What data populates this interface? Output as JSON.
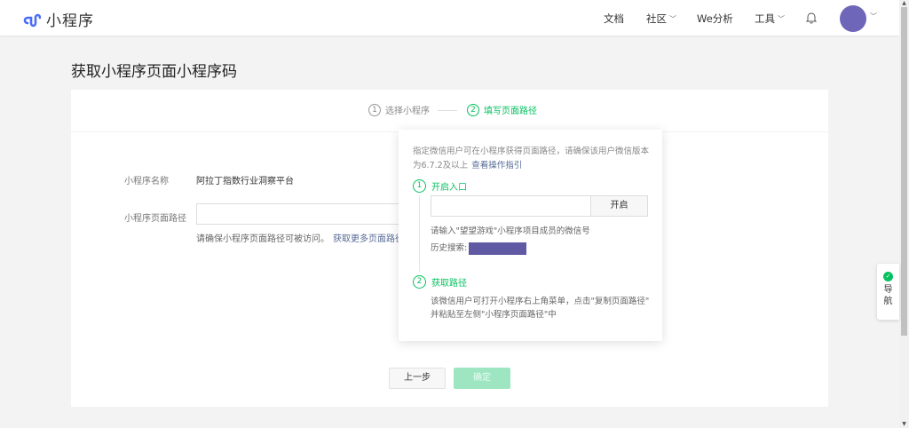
{
  "header": {
    "app_name": "小程序",
    "nav": {
      "docs": "文档",
      "community": "社区",
      "we_analytics": "We分析",
      "tools": "工具"
    },
    "icons": [
      "miniprogram-logo-icon",
      "chevron-down-icon",
      "bell-icon",
      "avatar"
    ]
  },
  "page": {
    "title": "获取小程序页面小程序码"
  },
  "steps": [
    {
      "num": "1",
      "label": "选择小程序"
    },
    {
      "num": "2",
      "label": "填写页面路径"
    }
  ],
  "form": {
    "name_label": "小程序名称",
    "name_value": "阿拉丁指数行业洞察平台",
    "path_label": "小程序页面路径",
    "path_value": "",
    "hint": "请确保小程序页面路径可被访问。",
    "hint_link": "获取更多页面路径"
  },
  "buttons": {
    "prev": "上一步",
    "confirm": "确定"
  },
  "popover": {
    "intro": "指定微信用户可在小程序获得页面路径，请确保该用户微信版本为6.7.2及以上",
    "intro_link": "查看操作指引",
    "step1_num": "1",
    "step1_title": "开启入口",
    "input_value": "",
    "open_button": "开启",
    "input_hint": "请输入\"望望游戏\"小程序项目成员的微信号",
    "history_label": "历史搜索:",
    "step2_num": "2",
    "step2_title": "获取路径",
    "step2_line1": "该微信用户可打开小程序右上角菜单，点击\"复制页面路径\"",
    "step2_line2": "并粘贴至左侧\"小程序页面路径\"中"
  },
  "side_nav": {
    "label_1": "导",
    "label_2": "航"
  },
  "colors": {
    "brand_green": "#07c160",
    "link_blue": "#576b95",
    "avatar_purple": "#6e66b8",
    "logo_blue": "#4a6cf7"
  }
}
